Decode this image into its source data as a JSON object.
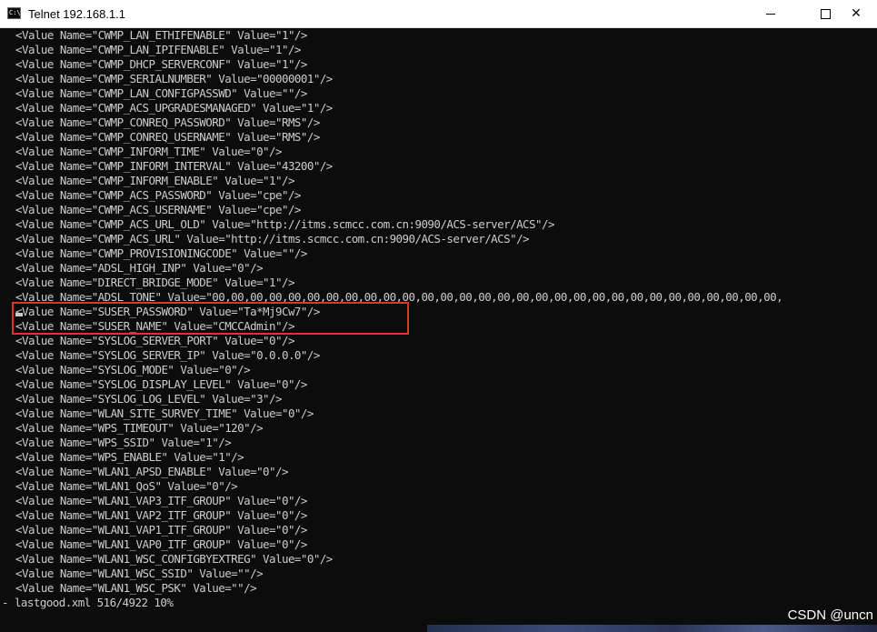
{
  "window": {
    "title": "Telnet 192.168.1.1",
    "icon": "console-app-icon",
    "icon_text": "C:\\",
    "minimize_icon": "minimize-icon",
    "maximize_icon": "maximize-icon",
    "close_symbol": "✕"
  },
  "console": {
    "lines": [
      "<Value Name=\"CWMP_LAN_ETHIFENABLE\" Value=\"1\"/>",
      "<Value Name=\"CWMP_LAN_IPIFENABLE\" Value=\"1\"/>",
      "<Value Name=\"CWMP_DHCP_SERVERCONF\" Value=\"1\"/>",
      "<Value Name=\"CWMP_SERIALNUMBER\" Value=\"00000001\"/>",
      "<Value Name=\"CWMP_LAN_CONFIGPASSWD\" Value=\"\"/>",
      "<Value Name=\"CWMP_ACS_UPGRADESMANAGED\" Value=\"1\"/>",
      "<Value Name=\"CWMP_CONREQ_PASSWORD\" Value=\"RMS\"/>",
      "<Value Name=\"CWMP_CONREQ_USERNAME\" Value=\"RMS\"/>",
      "<Value Name=\"CWMP_INFORM_TIME\" Value=\"0\"/>",
      "<Value Name=\"CWMP_INFORM_INTERVAL\" Value=\"43200\"/>",
      "<Value Name=\"CWMP_INFORM_ENABLE\" Value=\"1\"/>",
      "<Value Name=\"CWMP_ACS_PASSWORD\" Value=\"cpe\"/>",
      "<Value Name=\"CWMP_ACS_USERNAME\" Value=\"cpe\"/>",
      "<Value Name=\"CWMP_ACS_URL_OLD\" Value=\"http://itms.scmcc.com.cn:9090/ACS-server/ACS\"/>",
      "<Value Name=\"CWMP_ACS_URL\" Value=\"http://itms.scmcc.com.cn:9090/ACS-server/ACS\"/>",
      "<Value Name=\"CWMP_PROVISIONINGCODE\" Value=\"\"/>",
      "<Value Name=\"ADSL_HIGH_INP\" Value=\"0\"/>",
      "<Value Name=\"DIRECT_BRIDGE_MODE\" Value=\"1\"/>",
      "<Value Name=\"ADSL_TONE\" Value=\"00,00,00,00,00,00,00,00,00,00,00,00,00,00,00,00,00,00,00,00,00,00,00,00,00,00,00,00,00,00,",
      "<Value Name=\"SUSER_PASSWORD\" Value=\"Ta*Mj9Cw7\"/>",
      "<Value Name=\"SUSER_NAME\" Value=\"CMCCAdmin\"/>",
      "<Value Name=\"SYSLOG_SERVER_PORT\" Value=\"0\"/>",
      "<Value Name=\"SYSLOG_SERVER_IP\" Value=\"0.0.0.0\"/>",
      "<Value Name=\"SYSLOG_MODE\" Value=\"0\"/>",
      "<Value Name=\"SYSLOG_DISPLAY_LEVEL\" Value=\"0\"/>",
      "<Value Name=\"SYSLOG_LOG_LEVEL\" Value=\"3\"/>",
      "<Value Name=\"WLAN_SITE_SURVEY_TIME\" Value=\"0\"/>",
      "<Value Name=\"WPS_TIMEOUT\" Value=\"120\"/>",
      "<Value Name=\"WPS_SSID\" Value=\"1\"/>",
      "<Value Name=\"WPS_ENABLE\" Value=\"1\"/>",
      "<Value Name=\"WLAN1_APSD_ENABLE\" Value=\"0\"/>",
      "<Value Name=\"WLAN1_QoS\" Value=\"0\"/>",
      "<Value Name=\"WLAN1_VAP3_ITF_GROUP\" Value=\"0\"/>",
      "<Value Name=\"WLAN1_VAP2_ITF_GROUP\" Value=\"0\"/>",
      "<Value Name=\"WLAN1_VAP1_ITF_GROUP\" Value=\"0\"/>",
      "<Value Name=\"WLAN1_VAP0_ITF_GROUP\" Value=\"0\"/>",
      "<Value Name=\"WLAN1_WSC_CONFIGBYEXTREG\" Value=\"0\"/>",
      "<Value Name=\"WLAN1_WSC_SSID\" Value=\"\"/>",
      "<Value Name=\"WLAN1_WSC_PSK\" Value=\"\"/>"
    ],
    "status": "- lastgood.xml 516/4922 10%",
    "highlight_color": "#e0322f"
  },
  "watermark": {
    "text": "CSDN @uncn"
  }
}
